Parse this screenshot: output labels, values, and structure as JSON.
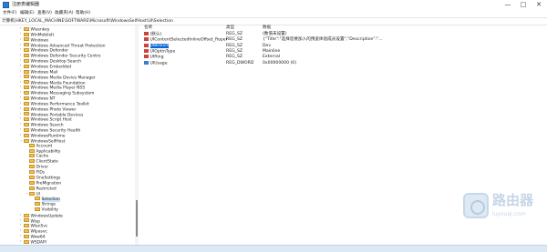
{
  "window": {
    "title": "注册表编辑器",
    "minimize_glyph": "—",
    "maximize_glyph": "□",
    "close_glyph": "✕"
  },
  "menu": [
    "文件(F)",
    "编辑(E)",
    "查看(V)",
    "收藏夹(A)",
    "帮助(H)"
  ],
  "address": "计算机\\HKEY_LOCAL_MACHINE\\SOFTWARE\\Microsoft\\WindowsSelfHost\\UI\\Selection",
  "tree": [
    {
      "label": "Wisenkey",
      "level": 3,
      "expander": "›"
    },
    {
      "label": "WinMobileIt",
      "level": 3,
      "expander": "›"
    },
    {
      "label": "Windows",
      "level": 3,
      "expander": "›"
    },
    {
      "label": "Windows Advanced Threat Protection",
      "level": 3,
      "expander": "›"
    },
    {
      "label": "Windows Defender",
      "level": 3,
      "expander": "›"
    },
    {
      "label": "Windows Defender Security Centre",
      "level": 3,
      "expander": "›"
    },
    {
      "label": "Windows Desktop Search",
      "level": 3,
      "expander": "›"
    },
    {
      "label": "Windows Embedded",
      "level": 3,
      "expander": "›"
    },
    {
      "label": "Windows Mail",
      "level": 3,
      "expander": "›"
    },
    {
      "label": "Windows Media Device Manager",
      "level": 3,
      "expander": "›"
    },
    {
      "label": "Windows Media Foundation",
      "level": 3,
      "expander": "›"
    },
    {
      "label": "Windows Media Player NSS",
      "level": 3,
      "expander": "›"
    },
    {
      "label": "Windows Messaging Subsystem",
      "level": 3,
      "expander": "›"
    },
    {
      "label": "Windows NT",
      "level": 3,
      "expander": "›"
    },
    {
      "label": "Windows Performance Toolkit",
      "level": 3,
      "expander": "›"
    },
    {
      "label": "Windows Photo Viewer",
      "level": 3,
      "expander": "›"
    },
    {
      "label": "Windows Portable Devices",
      "level": 3,
      "expander": "›"
    },
    {
      "label": "Windows Script Host",
      "level": 3,
      "expander": "›"
    },
    {
      "label": "Windows Search",
      "level": 3,
      "expander": "›"
    },
    {
      "label": "Windows Security Health",
      "level": 3,
      "expander": "›"
    },
    {
      "label": "WindowsRuntime",
      "level": 3,
      "expander": "›"
    },
    {
      "label": "WindowsSelfHost",
      "level": 3,
      "expander": "⌄"
    },
    {
      "label": "Account",
      "level": 4,
      "expander": ""
    },
    {
      "label": "Applicability",
      "level": 4,
      "expander": ""
    },
    {
      "label": "Cache",
      "level": 4,
      "expander": ""
    },
    {
      "label": "ClientState",
      "level": 4,
      "expander": ""
    },
    {
      "label": "Driver",
      "level": 4,
      "expander": ""
    },
    {
      "label": "FIDs",
      "level": 4,
      "expander": ""
    },
    {
      "label": "OneSettings",
      "level": 4,
      "expander": ""
    },
    {
      "label": "PreMigration",
      "level": 4,
      "expander": ""
    },
    {
      "label": "Restricted",
      "level": 4,
      "expander": ""
    },
    {
      "label": "UI",
      "level": 4,
      "expander": "⌄"
    },
    {
      "label": "Selection",
      "level": 5,
      "expander": "",
      "selected": true
    },
    {
      "label": "Strings",
      "level": 5,
      "expander": ""
    },
    {
      "label": "Visibility",
      "level": 5,
      "expander": ""
    },
    {
      "label": "WindowsUpdate",
      "level": 3,
      "expander": "›"
    },
    {
      "label": "Wisp",
      "level": 3,
      "expander": "›"
    },
    {
      "label": "WlanSvc",
      "level": 3,
      "expander": "›"
    },
    {
      "label": "Wlpasvc",
      "level": 3,
      "expander": "›"
    },
    {
      "label": "Wow64",
      "level": 3,
      "expander": "›"
    },
    {
      "label": "WSDAPI",
      "level": 3,
      "expander": "›"
    }
  ],
  "columns": {
    "name": "名称",
    "type": "类型",
    "data": "数据"
  },
  "values": [
    {
      "icon": "ab",
      "name": "(默认)",
      "type": "REG_SZ",
      "data": "(数值未设置)"
    },
    {
      "icon": "ab",
      "name": "UIContentSelectedInlineOffset_Roper",
      "type": "REG_SZ",
      "data": "{\"Title\":\"选择您要加入的预览体验成员设置\",\"Description\":\"..."
    },
    {
      "icon": "ab",
      "name": "UIBranch",
      "type": "REG_SZ",
      "data": "Dev",
      "selected": true
    },
    {
      "icon": "ab",
      "name": "UIOptinType",
      "type": "REG_SZ",
      "data": "Mainline"
    },
    {
      "icon": "ab",
      "name": "UIRing",
      "type": "REG_SZ",
      "data": "External"
    },
    {
      "icon": "bin",
      "name": "UIUsage",
      "type": "REG_DWORD",
      "data": "0x00000000 (0)"
    }
  ],
  "watermark": {
    "text": "路由器",
    "sub": "luyouqi.com"
  }
}
